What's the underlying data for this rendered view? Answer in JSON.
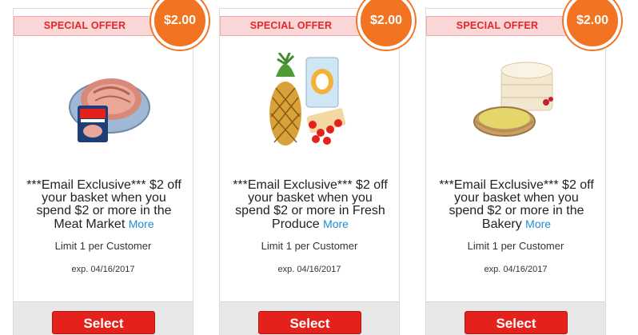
{
  "offers": [
    {
      "banner": "SPECIAL OFFER",
      "price": "$2.00",
      "image_icon": "ham-product-icon",
      "description": "***Email Exclusive*** $2 off your basket when you spend $2 or more in the Meat Market",
      "more_label": "More",
      "limit": "Limit 1 per Customer",
      "expiration": "exp. 04/16/2017",
      "button_label": "Select"
    },
    {
      "banner": "SPECIAL OFFER",
      "price": "$2.00",
      "image_icon": "produce-product-icon",
      "description": "***Email Exclusive*** $2 off your basket when you spend $2 or more in Fresh Produce",
      "more_label": "More",
      "limit": "Limit 1 per Customer",
      "expiration": "exp. 04/16/2017",
      "button_label": "Select"
    },
    {
      "banner": "SPECIAL OFFER",
      "price": "$2.00",
      "image_icon": "bakery-product-icon",
      "description": "***Email Exclusive*** $2 off your basket when you spend $2 or more in the Bakery",
      "more_label": "More",
      "limit": "Limit 1 per Customer",
      "expiration": "exp. 04/16/2017",
      "button_label": "Select"
    }
  ],
  "colors": {
    "badge": "#f27321",
    "banner_text": "#e3262a",
    "banner_bg": "#fbd6d6",
    "button": "#e4211b",
    "link": "#1a8fd0"
  }
}
